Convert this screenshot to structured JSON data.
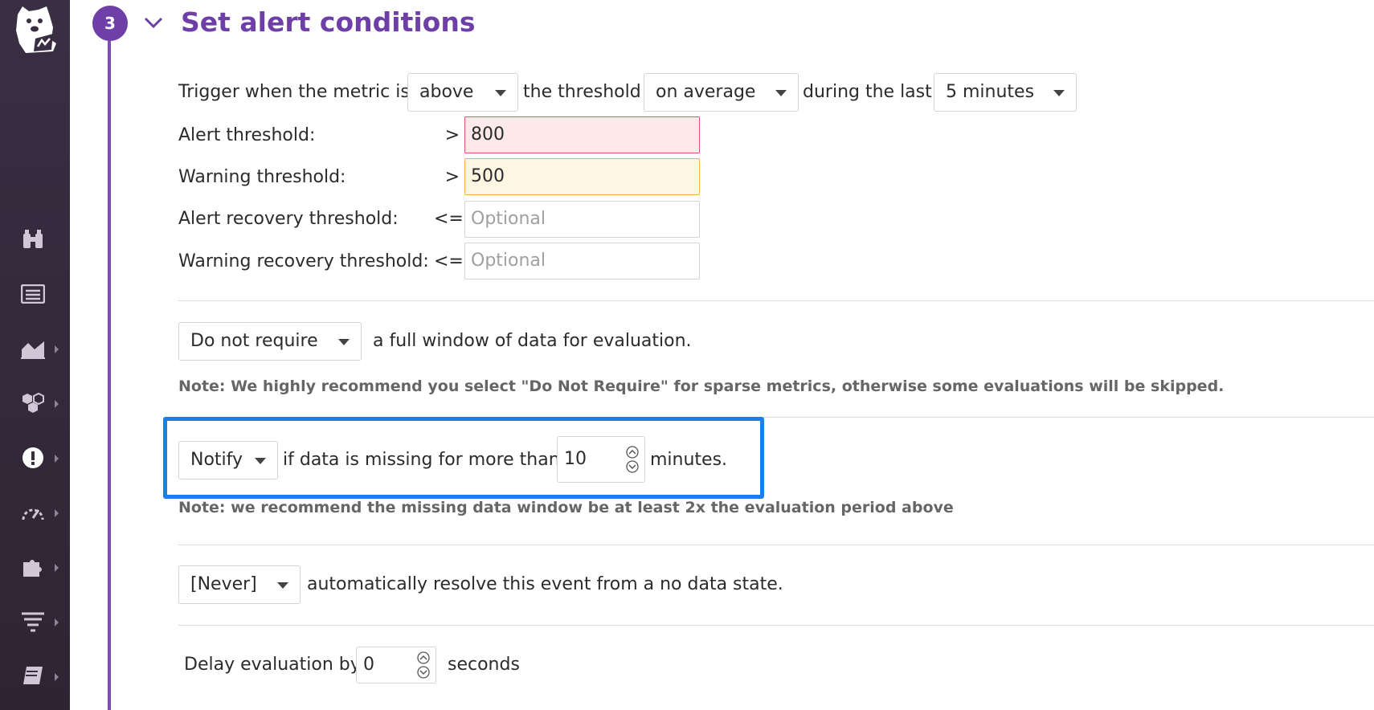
{
  "sidebar": {
    "items": [
      {
        "icon": "binoculars-icon",
        "has_submenu": false
      },
      {
        "icon": "list-icon",
        "has_submenu": false
      },
      {
        "icon": "area-chart-icon",
        "has_submenu": true
      },
      {
        "icon": "hexagons-icon",
        "has_submenu": true
      },
      {
        "icon": "alert-icon",
        "has_submenu": true,
        "active": true
      },
      {
        "icon": "gauge-icon",
        "has_submenu": true
      },
      {
        "icon": "puzzle-icon",
        "has_submenu": true
      },
      {
        "icon": "filter-lines-icon",
        "has_submenu": true
      },
      {
        "icon": "book-icon",
        "has_submenu": true
      }
    ]
  },
  "step": {
    "number": "3",
    "title": "Set alert conditions"
  },
  "trigger": {
    "prefix": "Trigger when the metric is",
    "comparison_value": "above",
    "middle": "the threshold",
    "aggregation_value": "on average",
    "during": "during the last",
    "window_value": "5 minutes"
  },
  "thresholds": [
    {
      "label": "Alert threshold:",
      "operator": ">",
      "value": "800",
      "placeholder": ""
    },
    {
      "label": "Warning threshold:",
      "operator": ">",
      "value": "500",
      "placeholder": ""
    },
    {
      "label": "Alert recovery threshold:",
      "operator": "<=",
      "value": "",
      "placeholder": "Optional"
    },
    {
      "label": "Warning recovery threshold:",
      "operator": "<=",
      "value": "",
      "placeholder": "Optional"
    }
  ],
  "full_window": {
    "select_value": "Do not require",
    "suffix": "a full window of data for evaluation.",
    "note": "Note: We highly recommend you select \"Do Not Require\" for sparse metrics, otherwise some evaluations will be skipped."
  },
  "missing_data": {
    "select_value": "Notify",
    "middle": "if data is missing for more than",
    "minutes_value": "10",
    "suffix": "minutes.",
    "note": "Note: we recommend the missing data window be at least 2x the evaluation period above"
  },
  "auto_resolve": {
    "select_value": "[Never]",
    "suffix": "automatically resolve this event from a no data state."
  },
  "delay": {
    "prefix": "Delay evaluation by",
    "seconds_value": "0",
    "suffix": "seconds"
  },
  "colors": {
    "accent_purple": "#6e3fa6",
    "highlight_blue": "#1a7fe6",
    "alert_bg": "#fde8ea",
    "warn_bg": "#fff5e3"
  }
}
